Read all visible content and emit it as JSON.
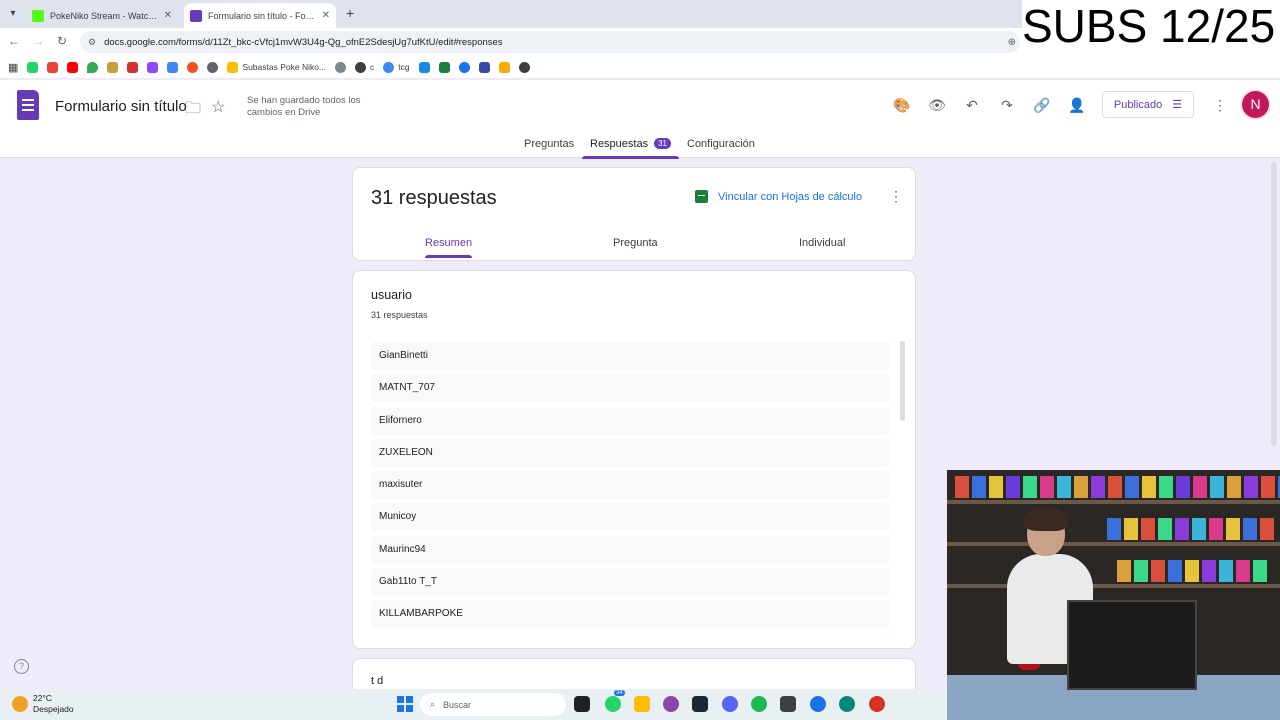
{
  "browser": {
    "tabs": [
      {
        "title": "PokeNiko Stream - Watch Live on",
        "favicon_color": "#53fc18"
      },
      {
        "title": "Formulario sin título - Formular",
        "favicon_color": "#673ab7"
      }
    ],
    "url": "docs.google.com/forms/d/11Zt_bkc-cVfcj1mvW3U4g-Qg_ofnE2SdesjUg7ufKtU/edit#responses",
    "bookmarks": [
      {
        "label": "Subastas Poke Niko...",
        "color": "#fbbc04"
      },
      {
        "label": "c",
        "color": "#3c4043"
      },
      {
        "label": "tcg",
        "color": "#4285f4"
      }
    ]
  },
  "overlay": {
    "subs_text": "SUBS 12/25"
  },
  "form": {
    "title": "Formulario sin título",
    "saved_status": "Se han guardado todos los cambios en Drive",
    "publish_label": "Publicado",
    "avatar_letter": "N",
    "tabs": {
      "questions": "Preguntas",
      "responses": "Respuestas",
      "responses_count": "31",
      "settings": "Configuración"
    }
  },
  "summary": {
    "count_title": "31 respuestas",
    "link_sheets": "Vincular con Hojas de cálculo",
    "subtabs": {
      "summary": "Resumen",
      "question": "Pregunta",
      "individual": "Individual"
    }
  },
  "question": {
    "title": "usuario",
    "count": "31 respuestas",
    "responses": [
      "GianBinetti",
      "MATNT_707",
      "Elifornero",
      "ZUXELEON",
      "maxisuter",
      "Municoy",
      "Maurinc94",
      "Gab11to T_T",
      "KILLAMBARPOKE"
    ]
  },
  "next_card": {
    "peek": "t d"
  },
  "taskbar": {
    "temperature": "22°C",
    "condition": "Despejado",
    "search_placeholder": "Buscar",
    "whatsapp_badge": "34"
  },
  "colors": {
    "accent": "#673ab7",
    "background": "#f0ebf8",
    "link": "#1a73e8"
  }
}
